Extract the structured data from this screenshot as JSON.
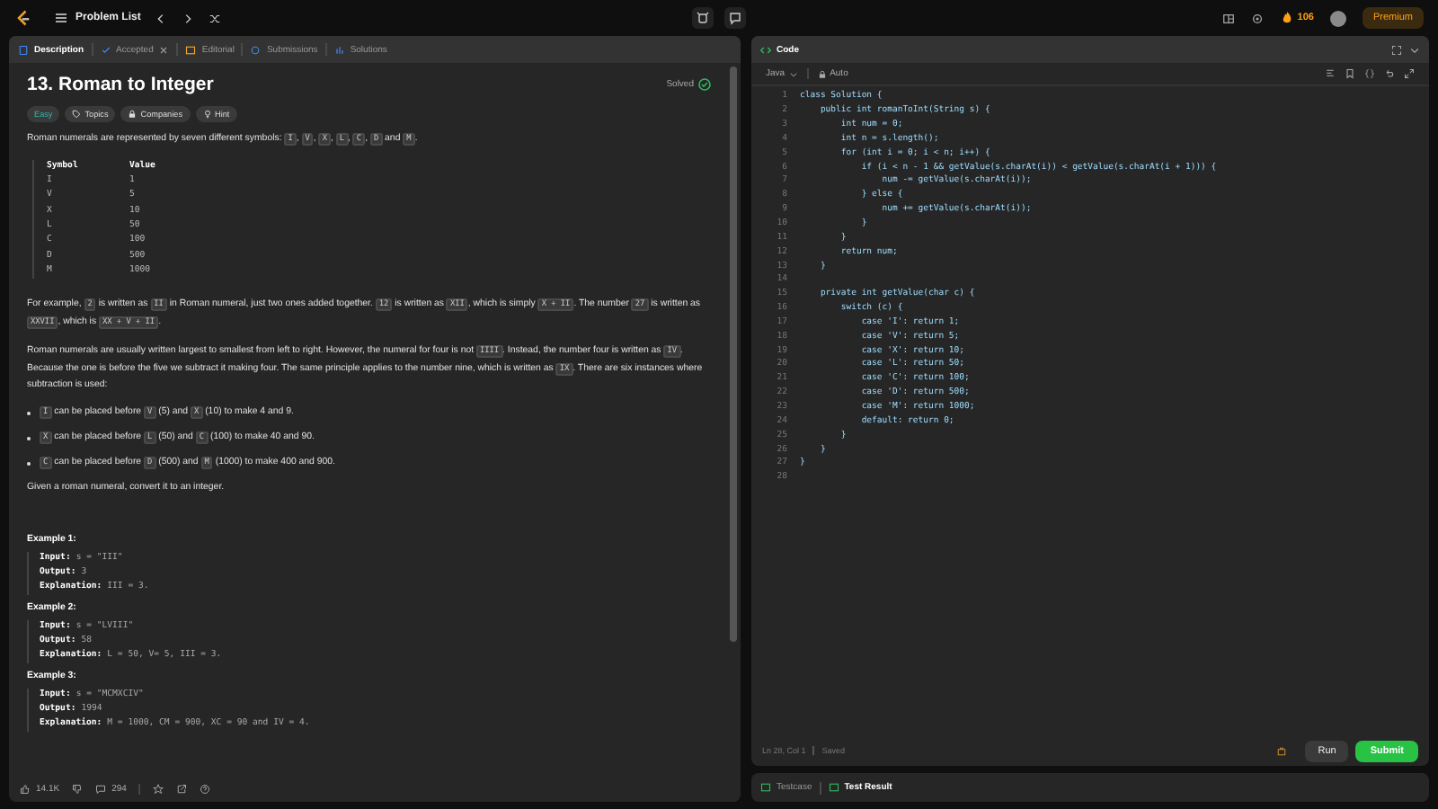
{
  "topbar": {
    "problem_list": "Problem List",
    "streak": "106",
    "premium": "Premium"
  },
  "left_tabs": [
    {
      "label": "Description",
      "selected": true,
      "closable": false
    },
    {
      "label": "Accepted",
      "selected": false,
      "closable": true
    },
    {
      "label": "Editorial",
      "selected": false,
      "closable": false
    },
    {
      "label": "Submissions",
      "selected": false,
      "closable": false
    },
    {
      "label": "Solutions",
      "selected": false,
      "closable": false
    }
  ],
  "problem": {
    "title": "13. Roman to Integer",
    "status": "Solved",
    "tags": [
      {
        "label": "Easy",
        "kind": "difficulty"
      },
      {
        "label": "Topics",
        "kind": "topics"
      },
      {
        "label": "Companies",
        "kind": "companies"
      },
      {
        "label": "Hint",
        "kind": "hint"
      }
    ]
  },
  "intro": [
    "Roman numerals are represented by seven different symbols: ",
    {
      "code": "I"
    },
    ", ",
    {
      "code": "V"
    },
    ", ",
    {
      "code": "X"
    },
    ", ",
    {
      "code": "L"
    },
    ", ",
    {
      "code": "C"
    },
    ", ",
    {
      "code": "D"
    },
    " and ",
    {
      "code": "M"
    },
    "."
  ],
  "symbol_table": {
    "columns": [
      "Symbol",
      "Value"
    ],
    "rows": [
      [
        "I",
        "1"
      ],
      [
        "V",
        "5"
      ],
      [
        "X",
        "10"
      ],
      [
        "L",
        "50"
      ],
      [
        "C",
        "100"
      ],
      [
        "D",
        "500"
      ],
      [
        "M",
        "1000"
      ]
    ]
  },
  "paragraphs": [
    [
      "For example, ",
      {
        "code": "2"
      },
      " is written as ",
      {
        "code": "II"
      },
      " in Roman numeral, just two ones added together. ",
      {
        "code": "12"
      },
      " is written as ",
      {
        "code": "XII"
      },
      ", which is simply ",
      {
        "code": "X + II"
      },
      ". The number ",
      {
        "code": "27"
      },
      " is written as ",
      {
        "code": "XXVII"
      },
      ", which is ",
      {
        "code": "XX + V + II"
      },
      "."
    ],
    [
      "Roman numerals are usually written largest to smallest from left to right. However, the numeral for four is not ",
      {
        "code": "IIII"
      },
      ". Instead, the number four is written as ",
      {
        "code": "IV"
      },
      ". Because the one is before the five we subtract it making four. The same principle applies to the number nine, which is written as ",
      {
        "code": "IX"
      },
      ". There are six instances where subtraction is used:"
    ]
  ],
  "bullets": [
    [
      {
        "code": "I"
      },
      " can be placed before ",
      {
        "code": "V"
      },
      " (5) and ",
      {
        "code": "X"
      },
      " (10) to make 4 and 9."
    ],
    [
      {
        "code": "X"
      },
      " can be placed before ",
      {
        "code": "L"
      },
      " (50) and ",
      {
        "code": "C"
      },
      " (100) to make 40 and 90."
    ],
    [
      {
        "code": "C"
      },
      " can be placed before ",
      {
        "code": "D"
      },
      " (500) and ",
      {
        "code": "M"
      },
      " (1000) to make 400 and 900."
    ]
  ],
  "closing": "Given a roman numeral, convert it to an integer.",
  "examples": [
    {
      "title": "Example 1:",
      "lines": [
        {
          "label": "Input:",
          "value": "s = \"III\""
        },
        {
          "label": "Output:",
          "value": "3"
        },
        {
          "label": "Explanation:",
          "value": "III = 3."
        }
      ]
    },
    {
      "title": "Example 2:",
      "lines": [
        {
          "label": "Input:",
          "value": "s = \"LVIII\""
        },
        {
          "label": "Output:",
          "value": "58"
        },
        {
          "label": "Explanation:",
          "value": "L = 50, V= 5, III = 3."
        }
      ]
    },
    {
      "title": "Example 3:",
      "lines": [
        {
          "label": "Input:",
          "value": "s = \"MCMXCIV\""
        },
        {
          "label": "Output:",
          "value": "1994"
        },
        {
          "label": "Explanation:",
          "value": "M = 1000, CM = 900, XC = 90 and IV = 4."
        }
      ]
    }
  ],
  "footer": {
    "likes": "14.1K",
    "comments": "294"
  },
  "editor": {
    "title": "Code",
    "language": "Java",
    "mode": "Auto",
    "status": "Ln 28, Col 1",
    "saved": "Saved",
    "run": "Run",
    "submit": "Submit",
    "lines": [
      {
        "n": "1",
        "code": "class Solution {"
      },
      {
        "n": "2",
        "code": "    public int romanToInt(String s) {"
      },
      {
        "n": "3",
        "code": "        int num = 0;"
      },
      {
        "n": "4",
        "code": "        int n = s.length();"
      },
      {
        "n": "5",
        "code": "        for (int i = 0; i < n; i++) {"
      },
      {
        "n": "6",
        "code": "            if (i < n - 1 && getValue(s.charAt(i)) < getValue(s.charAt(i + 1))) {"
      },
      {
        "n": "7",
        "code": "                num -= getValue(s.charAt(i));"
      },
      {
        "n": "8",
        "code": "            } else {"
      },
      {
        "n": "9",
        "code": "                num += getValue(s.charAt(i));"
      },
      {
        "n": "10",
        "code": "            }"
      },
      {
        "n": "11",
        "code": "        }"
      },
      {
        "n": "12",
        "code": "        return num;"
      },
      {
        "n": "13",
        "code": "    }"
      },
      {
        "n": "14"
      },
      {
        "n": "15",
        "code": "    private int getValue(char c) {"
      },
      {
        "n": "16",
        "code": "        switch (c) {"
      },
      {
        "n": "17",
        "code": "            case 'I': return 1;"
      },
      {
        "n": "18",
        "code": "            case 'V': return 5;"
      },
      {
        "n": "19",
        "code": "            case 'X': return 10;"
      },
      {
        "n": "20",
        "code": "            case 'L': return 50;"
      },
      {
        "n": "21",
        "code": "            case 'C': return 100;"
      },
      {
        "n": "22",
        "code": "            case 'D': return 500;"
      },
      {
        "n": "23",
        "code": "            case 'M': return 1000;"
      },
      {
        "n": "24",
        "code": "            default: return 0;"
      },
      {
        "n": "25",
        "code": "        }"
      },
      {
        "n": "26",
        "code": "    }"
      },
      {
        "n": "27",
        "code": "}"
      },
      {
        "n": "28"
      }
    ]
  },
  "bottom_tabs": [
    {
      "label": "Testcase",
      "selected": false
    },
    {
      "label": "Test Result",
      "selected": true
    }
  ]
}
